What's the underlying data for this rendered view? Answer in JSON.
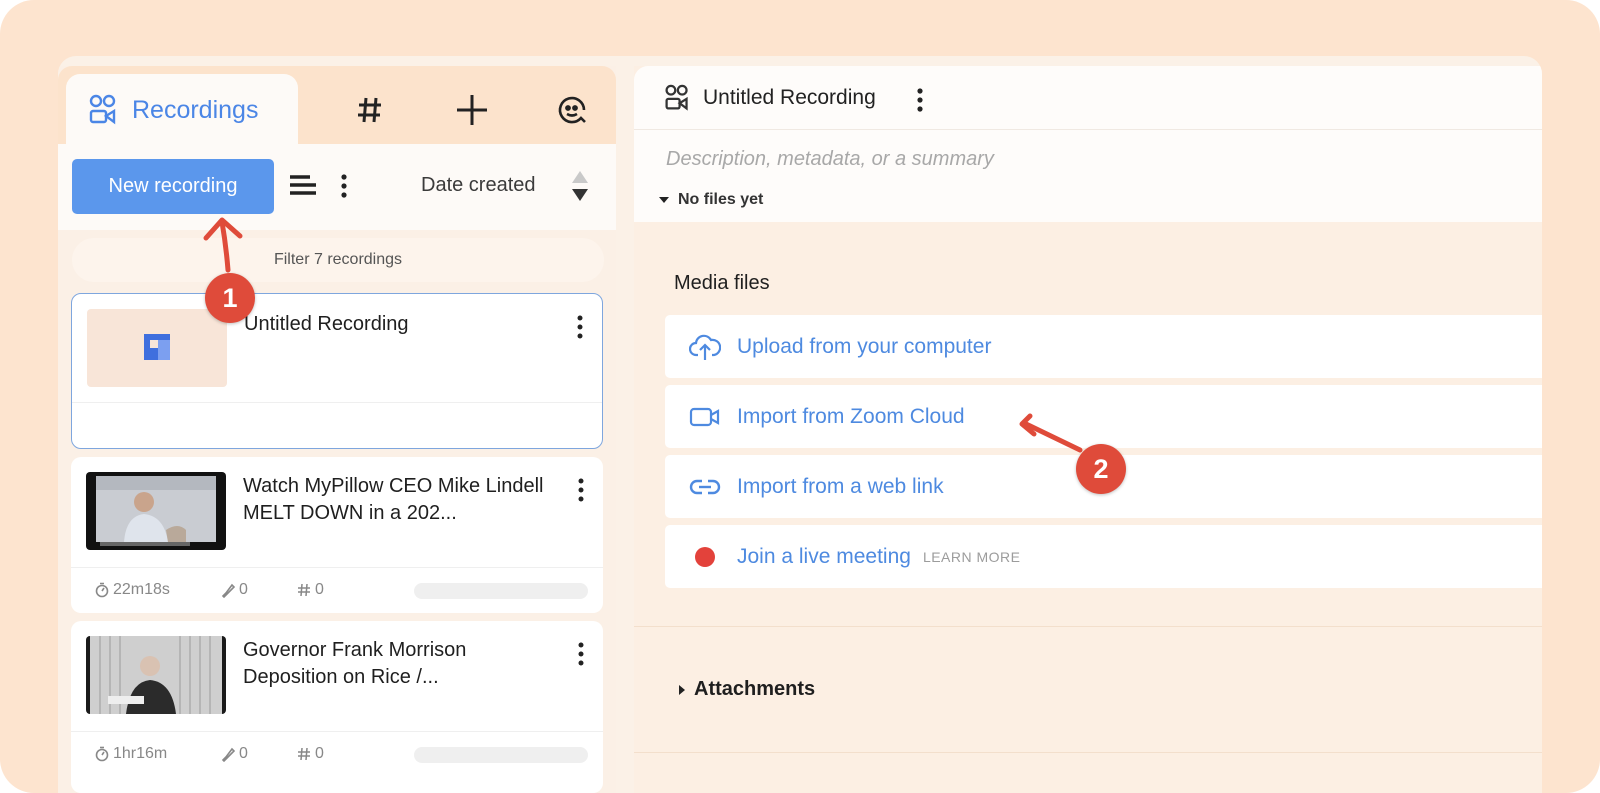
{
  "left_panel": {
    "tabs": [
      {
        "label": "Recordings",
        "icon": "recordings-icon",
        "active": true
      },
      {
        "label": "",
        "icon": "hash-icon"
      },
      {
        "label": "",
        "icon": "plus-icon"
      },
      {
        "label": "",
        "icon": "face-icon"
      }
    ],
    "new_recording_label": "New recording",
    "sort_label": "Date created",
    "filter_placeholder": "Filter 7 recordings",
    "recordings": [
      {
        "title": "Untitled Recording",
        "selected": true
      },
      {
        "title": "Watch MyPillow CEO Mike Lindell MELT DOWN in a 202...",
        "duration": "22m18s",
        "clips": "0",
        "tags": "0"
      },
      {
        "title": "Governor Frank Morrison Deposition on Rice /...",
        "duration": "1hr16m",
        "clips": "0",
        "tags": "0"
      }
    ]
  },
  "right_panel": {
    "title": "Untitled Recording",
    "description_placeholder": "Description, metadata, or a summary",
    "files_toggle_label": "No files yet",
    "media_section_title": "Media files",
    "media_options": [
      {
        "label": "Upload from your computer",
        "icon": "cloud-upload-icon"
      },
      {
        "label": "Import from Zoom Cloud",
        "icon": "video-camera-icon"
      },
      {
        "label": "Import from a web link",
        "icon": "link-icon"
      },
      {
        "label": "Join a live meeting",
        "icon": "record-dot-icon",
        "extra": "LEARN MORE"
      }
    ],
    "attachments_label": "Attachments"
  },
  "annotations": {
    "step1": "1",
    "step2": "2"
  },
  "colors": {
    "accent_blue": "#5b97ec",
    "link_blue": "#4e8ae0",
    "annotation_red": "#df4b3a",
    "live_red": "#e3423b",
    "frame_peach": "#fde4cf"
  }
}
